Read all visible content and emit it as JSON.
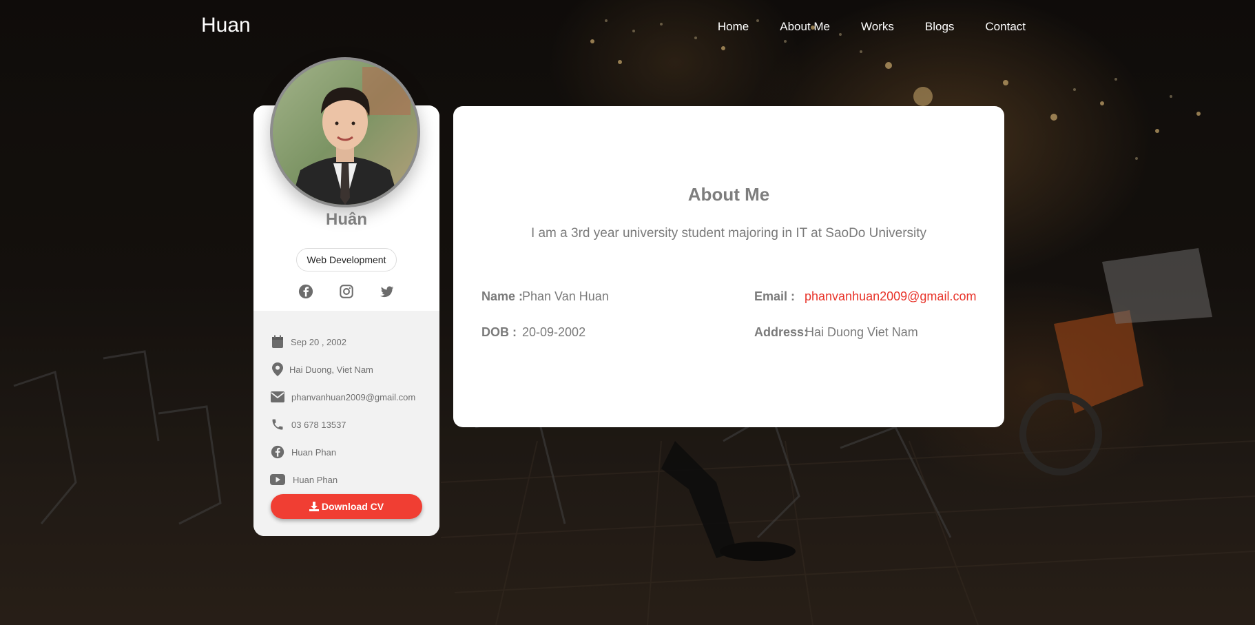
{
  "header": {
    "brand": "Huan",
    "nav": [
      "Home",
      "About Me",
      "Works",
      "Blogs",
      "Contact"
    ]
  },
  "profile": {
    "name": "Huân",
    "role": "Web Development",
    "socials": [
      "facebook-icon",
      "instagram-icon",
      "twitter-icon"
    ],
    "info": [
      {
        "icon": "calendar-icon",
        "text": "Sep 20 , 2002"
      },
      {
        "icon": "map-pin-icon",
        "text": "Hai Duong, Viet Nam"
      },
      {
        "icon": "envelope-icon",
        "text": "phanvanhuan2009@gmail.com"
      },
      {
        "icon": "phone-icon",
        "text": "03 678 13537"
      },
      {
        "icon": "facebook-icon",
        "text": "Huan Phan"
      },
      {
        "icon": "youtube-icon",
        "text": "Huan Phan"
      }
    ],
    "download_label": "Download CV"
  },
  "about": {
    "title": "About Me",
    "intro": "I am a 3rd year university student majoring in IT at SaoDo University",
    "fields": {
      "name_label": "Name :",
      "name_value": "Phan Van Huan",
      "dob_label": "DOB :",
      "dob_value": "20-09-2002",
      "email_label": "Email :",
      "email_value": "phanvanhuan2009@gmail.com",
      "address_label": "Address:",
      "address_value": "Hai Duong Viet Nam"
    }
  },
  "colors": {
    "accent": "#f03e33",
    "email": "#e8342a",
    "text_gray": "#7a7a7a"
  }
}
